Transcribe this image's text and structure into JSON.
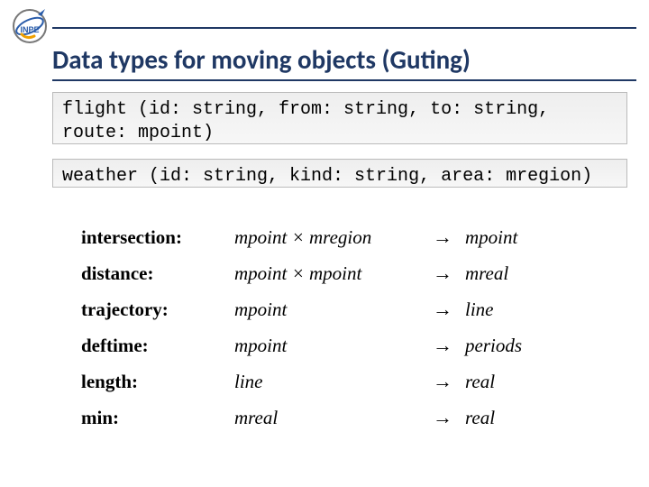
{
  "title": "Data types for moving objects (Guting)",
  "code1": "flight (id: string, from: string, to: string, route: mpoint)",
  "code2": "weather (id: string, kind: string, area: mregion)",
  "ops": [
    {
      "name": "intersection:",
      "sig": "mpoint × mregion",
      "arrow": "→",
      "res": "mpoint"
    },
    {
      "name": "distance:",
      "sig": "mpoint × mpoint",
      "arrow": "→",
      "res": "mreal"
    },
    {
      "name": "trajectory:",
      "sig": "mpoint",
      "arrow": "→",
      "res": "line"
    },
    {
      "name": "deftime:",
      "sig": "mpoint",
      "arrow": "→",
      "res": "periods"
    },
    {
      "name": "length:",
      "sig": "line",
      "arrow": "→",
      "res": "real"
    },
    {
      "name": "min:",
      "sig": "mreal",
      "arrow": "→",
      "res": "real"
    }
  ]
}
